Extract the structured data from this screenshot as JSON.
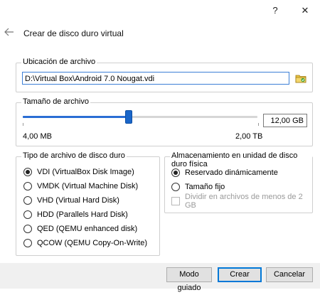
{
  "titlebar": {
    "help": "?",
    "close": "✕"
  },
  "dialog": {
    "back_icon": "arrow-left-icon",
    "title": "Crear de disco duro virtual"
  },
  "location": {
    "label": "Ubicación de archivo",
    "path": "D:\\Virtual Box\\Android 7.0 Nougat.vdi",
    "browse_icon": "folder-browse-icon"
  },
  "size": {
    "label": "Tamaño de archivo",
    "value": "12,00 GB",
    "min_label": "4,00 MB",
    "max_label": "2,00 TB",
    "slider_fraction": 0.45
  },
  "filetype": {
    "label": "Tipo de archivo de disco duro",
    "options": [
      {
        "label": "VDI (VirtualBox Disk Image)",
        "checked": true
      },
      {
        "label": "VMDK (Virtual Machine Disk)",
        "checked": false
      },
      {
        "label": "VHD (Virtual Hard Disk)",
        "checked": false
      },
      {
        "label": "HDD (Parallels Hard Disk)",
        "checked": false
      },
      {
        "label": "QED (QEMU enhanced disk)",
        "checked": false
      },
      {
        "label": "QCOW (QEMU Copy-On-Write)",
        "checked": false
      }
    ]
  },
  "storage": {
    "label": "Almacenamiento en unidad de disco duro física",
    "options": [
      {
        "label": "Reservado dinámicamente",
        "checked": true
      },
      {
        "label": "Tamaño fijo",
        "checked": false
      }
    ],
    "split_label": "Dividir en archivos de menos de 2 GB"
  },
  "buttons": {
    "guided": "Modo guiado",
    "create": "Crear",
    "cancel": "Cancelar"
  }
}
